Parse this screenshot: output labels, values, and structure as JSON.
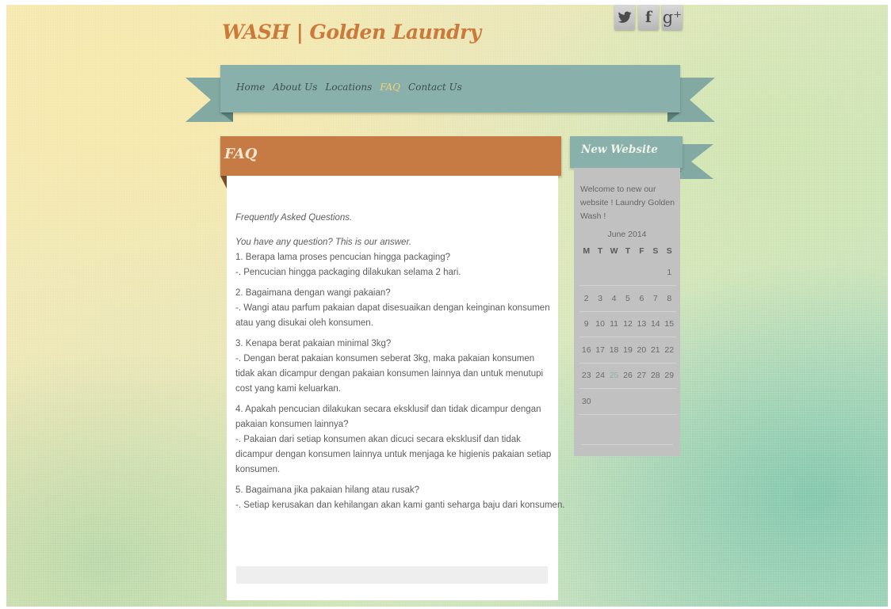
{
  "site": {
    "title": "WASH | Golden Laundry"
  },
  "social": [
    {
      "icon": "twitter-icon",
      "glyph": "𝕪"
    },
    {
      "icon": "facebook-icon",
      "glyph": "f"
    },
    {
      "icon": "google-plus-icon",
      "glyph": "g⁺"
    }
  ],
  "nav": {
    "items": [
      "Home",
      "About Us",
      "Locations",
      "FAQ",
      "Contact Us"
    ],
    "active": "FAQ"
  },
  "main": {
    "title": "FAQ",
    "intro": "Frequently Asked Questions.",
    "lead": "You have any question? This is our answer.",
    "qa": [
      {
        "q": "1. Berapa lama proses pencucian hingga packaging?",
        "a": "-. Pencucian hingga packaging dilakukan selama 2 hari."
      },
      {
        "q": "2. Bagaimana dengan wangi pakaian?",
        "a": "-. Wangi atau parfum pakaian dapat disesuaikan dengan keinginan konsumen atau yang disukai oleh konsumen."
      },
      {
        "q": "3. Kenapa berat pakaian minimal 3kg?",
        "a": "-. Dengan berat pakaian konsumen seberat 3kg, maka pakaian konsumen tidak akan dicampur dengan pakaian konsumen lainnya dan untuk menutupi cost yang kami keluarkan."
      },
      {
        "q": "4. Apakah pencucian dilakukan secara eksklusif dan tidak dicampur dengan pakaian konsumen lainnya?",
        "a": "-. Pakaian dari setiap konsumen akan dicuci secara eksklusif dan tidak dicampur dengan konsumen lainnya untuk menjaga ke higienis pakaian setiap konsumen."
      },
      {
        "q": "5. Bagaimana jika pakaian hilang atau rusak?",
        "a": "-. Setiap kerusakan dan kehilangan akan kami ganti seharga baju dari konsumen."
      }
    ]
  },
  "sidebar": {
    "title": "New Website",
    "welcome": "Welcome to new our website ! Laundry Golden Wash !",
    "calendar": {
      "caption": "June 2014",
      "weekdays": [
        "M",
        "T",
        "W",
        "T",
        "F",
        "S",
        "S"
      ],
      "weeks": [
        [
          "",
          "",
          "",
          "",
          "",
          "",
          "1"
        ],
        [
          "2",
          "3",
          "4",
          "5",
          "6",
          "7",
          "8"
        ],
        [
          "9",
          "10",
          "11",
          "12",
          "13",
          "14",
          "15"
        ],
        [
          "16",
          "17",
          "18",
          "19",
          "20",
          "21",
          "22"
        ],
        [
          "23",
          "24",
          "25",
          "26",
          "27",
          "28",
          "29"
        ],
        [
          "30",
          "",
          "",
          "",
          "",
          "",
          ""
        ]
      ],
      "today": "25"
    }
  }
}
